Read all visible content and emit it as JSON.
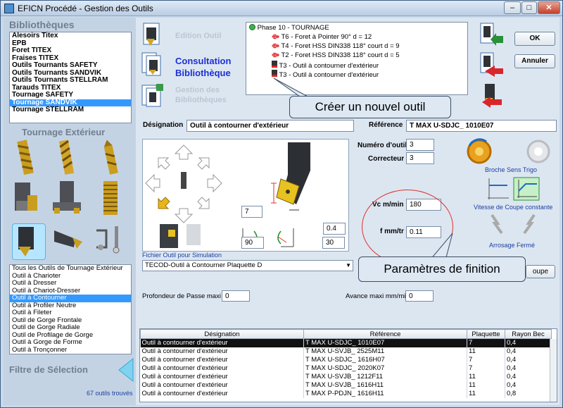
{
  "window": {
    "title": "EFICN Procédé - Gestion des Outils",
    "minimize": "‒",
    "maximize": "□",
    "close": "✕"
  },
  "left": {
    "bibliotheques_title": "Bibliothèques",
    "libraries": [
      "Alesoirs Titex",
      "EPB",
      "Foret TITEX",
      "Fraises TITEX",
      "Outils Tournants SAFETY",
      "Outils Tournants SANDVIK",
      "Outils Tournants STELLRAM",
      "Tarauds TITEX",
      "Tournage  SAFETY",
      "Tournage SANDVIK",
      "Tournage STELLRAM"
    ],
    "selected_library_index": 9,
    "category_title": "Tournage Extérieur",
    "tool_types": [
      "Tous les Outils de Tournage Extérieur",
      "Outil à Charioter",
      "Outil à Dresser",
      "Outil à Chariot-Dresser",
      "Outil à Contourner",
      "Outil à Profiler Neutre",
      "Outil à Fileter",
      "Outil de Gorge Frontale",
      "Outil de Gorge Radiale",
      "Outil de Profilage de Gorge",
      "Outil à Gorge de Forme",
      "Outil à Tronçonner"
    ],
    "selected_type_index": 4,
    "filter_title": "Filtre de Sélection",
    "found_count": "67 outils trouvés"
  },
  "modes": {
    "edition": "Edition Outil",
    "consultation_line1": "Consultation",
    "consultation_line2": "Bibliothèque",
    "gestion_line1": "Gestion des",
    "gestion_line2": "Bibliothèques"
  },
  "tree": {
    "phase": "Phase 10 - TOURNAGE",
    "items": [
      "T6 - Foret à Pointer 90° d = 12",
      "T4 - Foret HSS DIN338 118° court d = 9",
      "T2 - Foret HSS DIN338 118° court d = 5",
      "T3 - Outil à contourner d'extérieur",
      "T3 - Outil à contourner d'extérieur"
    ]
  },
  "buttons": {
    "ok": "OK",
    "annuler": "Annuler",
    "coupe": "oupe"
  },
  "callouts": {
    "create_tool": "Créer un nouvel outil",
    "finishing_params": "Paramètres de finition"
  },
  "form": {
    "designation_label": "Désignation",
    "designation_value": "Outil à contourner d'extérieur",
    "reference_label": "Référence",
    "reference_value": "T MAX U-SDJC_ 1010E07",
    "numero_label": "Numéro d'outil",
    "numero_value": "3",
    "correcteur_label": "Correcteur",
    "correcteur_value": "3",
    "vc_label": "Vc m/min",
    "vc_value": "180",
    "f_label": "f mm/tr",
    "f_value": "0.11",
    "dim_7": "7",
    "dim_04": "0.4",
    "dim_90": "90",
    "dim_30": "30",
    "broche_label": "Broche Sens Trigo",
    "vitesse_label": "Vitesse de Coupe constante",
    "arrosage_label": "Arrosage Fermé",
    "fichier_label": "Fichier Outil pour Simulation",
    "fichier_value": "TECOD-Outil à Contourner Plaquette D",
    "profondeur_label": "Profondeur de Passe maxi",
    "profondeur_value": "0",
    "avance_label": "Avance maxi mm/min",
    "avance_value": "0"
  },
  "table": {
    "headers": [
      "Désignation",
      "Référence",
      "Plaquette",
      "Rayon Bec"
    ],
    "rows": [
      [
        "Outil à contourner d'extérieur",
        "T MAX U-SDJC_ 1010E07",
        "7",
        "0,4"
      ],
      [
        "Outil à contourner d'extérieur",
        "T MAX U-SVJB_ 2525M11",
        "11",
        "0,4"
      ],
      [
        "Outil à contourner d'extérieur",
        "T MAX U-SDJC_ 1616H07",
        "7",
        "0,4"
      ],
      [
        "Outil à contourner d'extérieur",
        "T MAX U-SDJC_ 2020K07",
        "7",
        "0,4"
      ],
      [
        "Outil à contourner d'extérieur",
        "T MAX U-SVJB_ 1212F11",
        "11",
        "0,4"
      ],
      [
        "Outil à contourner d'extérieur",
        "T MAX U-SVJB_ 1616H11",
        "11",
        "0,4"
      ],
      [
        "Outil à contourner d'extérieur",
        "T MAX P-PDJN_ 1616H11",
        "11",
        "0,8"
      ]
    ],
    "selected_row_index": 0
  },
  "colors": {
    "accent_blue": "#1c3fa0",
    "selection": "#3399ff",
    "callout_border": "#e0322c"
  }
}
